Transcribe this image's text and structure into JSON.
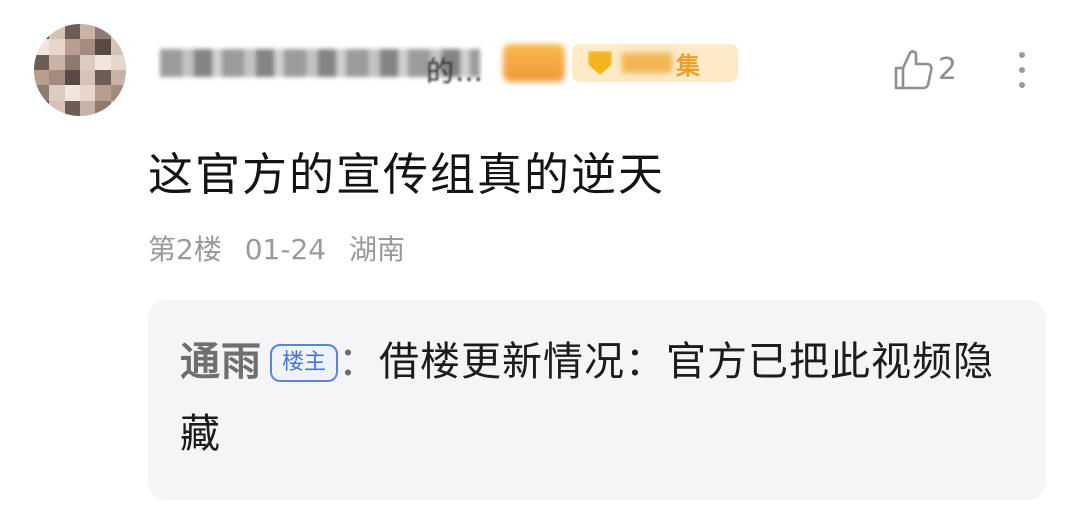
{
  "user": {
    "name_tail": "的…",
    "fan_badge_text": "集"
  },
  "actions": {
    "like_count": "2"
  },
  "comment": {
    "text": "这官方的宣传组真的逆天",
    "floor": "第2楼",
    "date": "01-24",
    "location": "湖南"
  },
  "reply": {
    "author": "通雨",
    "op_tag": "楼主",
    "separator": "：",
    "text": "借楼更新情况：官方已把此视频隐藏"
  },
  "colors": {
    "like_gray": "#8f8f8f",
    "op_tag_blue": "#4a74d8",
    "reply_bg": "#f5f5f7",
    "badge_orange": "#f29a3c"
  }
}
